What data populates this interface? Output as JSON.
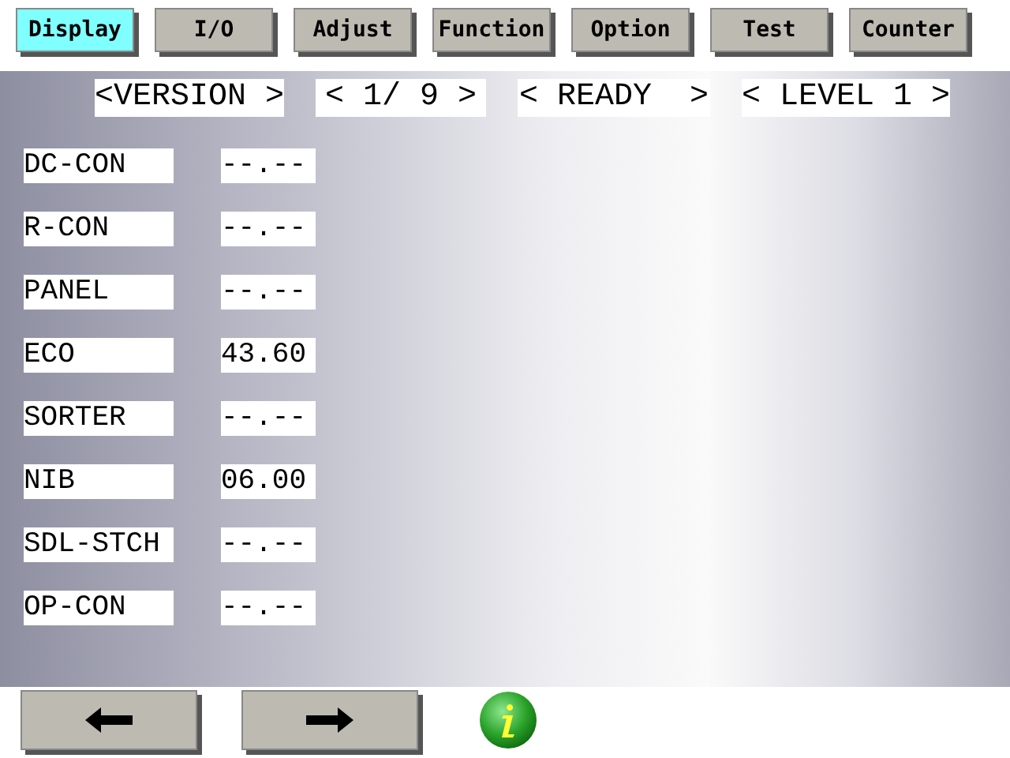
{
  "tabs": [
    {
      "label": "Display",
      "selected": true
    },
    {
      "label": "I/O",
      "selected": false
    },
    {
      "label": "Adjust",
      "selected": false
    },
    {
      "label": "Function",
      "selected": false
    },
    {
      "label": "Option",
      "selected": false
    },
    {
      "label": "Test",
      "selected": false
    },
    {
      "label": "Counter",
      "selected": false
    }
  ],
  "header": [
    "<VERSION >",
    "< 1/ 9 >",
    "< READY  >",
    "< LEVEL 1 >"
  ],
  "rows": [
    {
      "name": "DC-CON",
      "value": "--.--"
    },
    {
      "name": "R-CON",
      "value": "--.--"
    },
    {
      "name": "PANEL",
      "value": "--.--"
    },
    {
      "name": "ECO",
      "value": "43.60"
    },
    {
      "name": "SORTER",
      "value": "--.--"
    },
    {
      "name": "NIB",
      "value": "06.00"
    },
    {
      "name": "SDL-STCH",
      "value": "--.--"
    },
    {
      "name": "OP-CON",
      "value": "--.--"
    }
  ]
}
